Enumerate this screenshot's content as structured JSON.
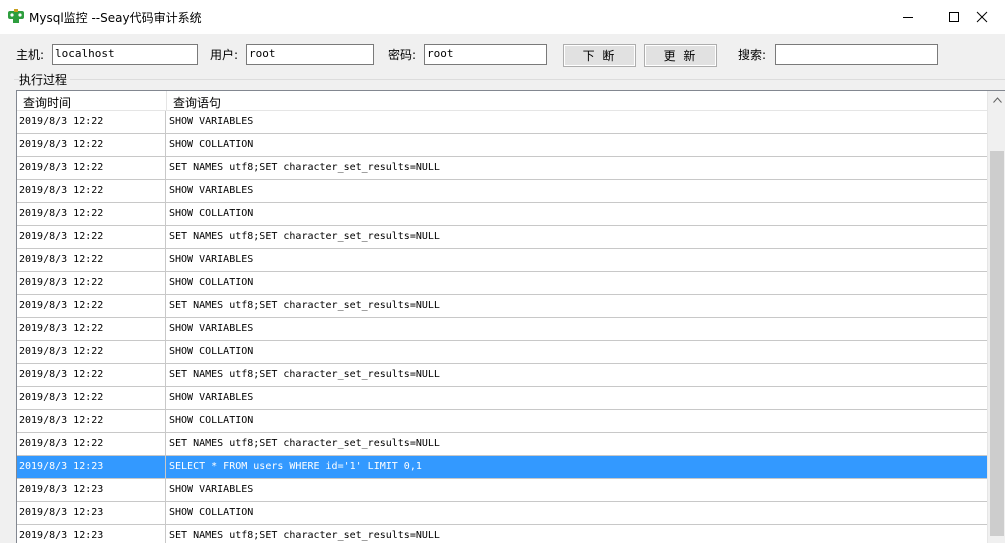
{
  "window": {
    "title": "Mysql监控 --Seay代码审计系统",
    "icon": "app-icon",
    "controls": [
      "minimize-icon",
      "maximize-icon",
      "close-icon"
    ]
  },
  "toolbar": {
    "host_label": "主机:",
    "host_value": "localhost",
    "user_label": "用户:",
    "user_value": "root",
    "password_label": "密码:",
    "password_value": "root",
    "disconnect_label": "下 断",
    "refresh_label": "更 新",
    "search_label": "搜索:",
    "search_value": ""
  },
  "process": {
    "group_label": "执行过程",
    "columns": [
      "查询时间",
      "查询语句"
    ],
    "rows": [
      {
        "time": "2019/8/3 12:22",
        "sql": "SHOW VARIABLES"
      },
      {
        "time": "2019/8/3 12:22",
        "sql": "SHOW COLLATION"
      },
      {
        "time": "2019/8/3 12:22",
        "sql": "SET NAMES utf8;SET character_set_results=NULL"
      },
      {
        "time": "2019/8/3 12:22",
        "sql": "SHOW VARIABLES"
      },
      {
        "time": "2019/8/3 12:22",
        "sql": "SHOW COLLATION"
      },
      {
        "time": "2019/8/3 12:22",
        "sql": "SET NAMES utf8;SET character_set_results=NULL"
      },
      {
        "time": "2019/8/3 12:22",
        "sql": "SHOW VARIABLES"
      },
      {
        "time": "2019/8/3 12:22",
        "sql": "SHOW COLLATION"
      },
      {
        "time": "2019/8/3 12:22",
        "sql": "SET NAMES utf8;SET character_set_results=NULL"
      },
      {
        "time": "2019/8/3 12:22",
        "sql": "SHOW VARIABLES"
      },
      {
        "time": "2019/8/3 12:22",
        "sql": "SHOW COLLATION"
      },
      {
        "time": "2019/8/3 12:22",
        "sql": "SET NAMES utf8;SET character_set_results=NULL"
      },
      {
        "time": "2019/8/3 12:22",
        "sql": "SHOW VARIABLES"
      },
      {
        "time": "2019/8/3 12:22",
        "sql": "SHOW COLLATION"
      },
      {
        "time": "2019/8/3 12:22",
        "sql": "SET NAMES utf8;SET character_set_results=NULL"
      },
      {
        "time": "2019/8/3 12:23",
        "sql": "SELECT * FROM users WHERE id='1' LIMIT 0,1",
        "selected": true
      },
      {
        "time": "2019/8/3 12:23",
        "sql": "SHOW VARIABLES"
      },
      {
        "time": "2019/8/3 12:23",
        "sql": "SHOW COLLATION"
      },
      {
        "time": "2019/8/3 12:23",
        "sql": "SET NAMES utf8;SET character_set_results=NULL"
      }
    ]
  },
  "colors": {
    "selection": "#3399ff",
    "window_bg": "#f0f0f0",
    "icon_green": "#2e9e3e"
  }
}
